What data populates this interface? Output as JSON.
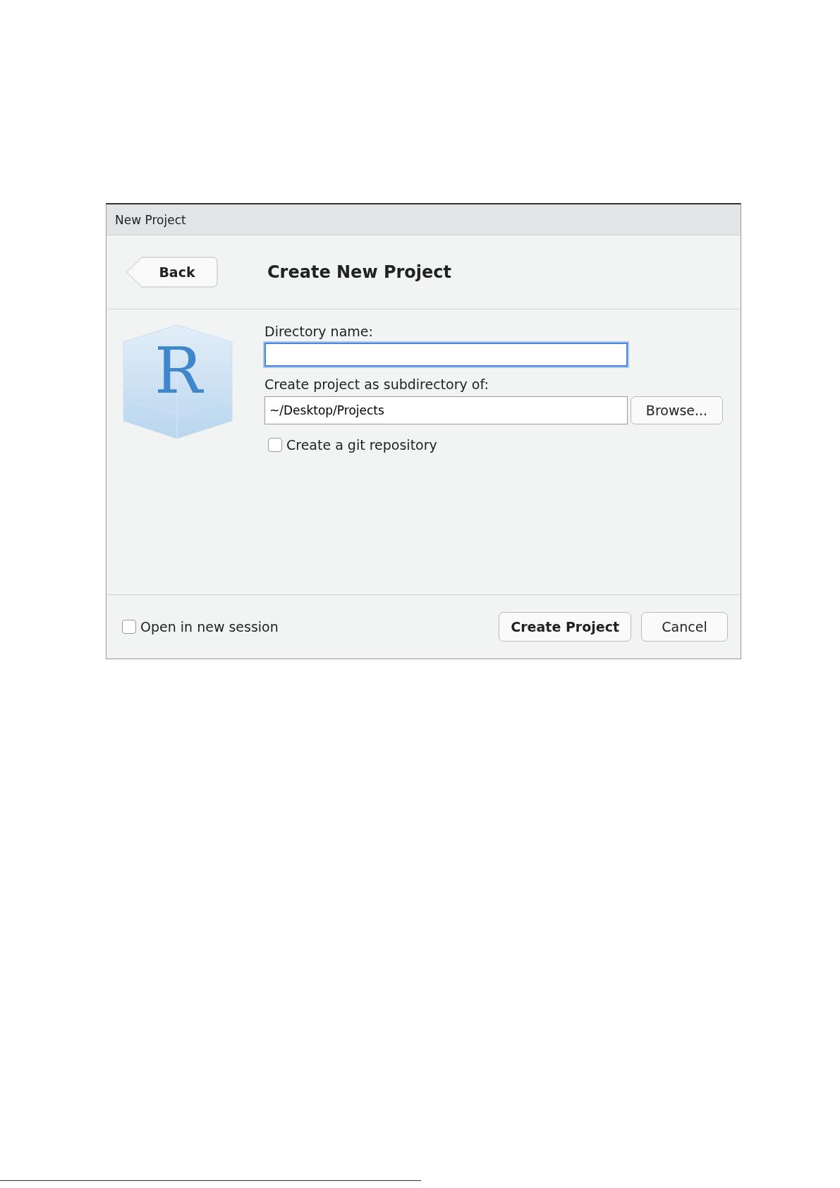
{
  "window": {
    "title": "New Project"
  },
  "header": {
    "back_button": "Back",
    "title": "Create New Project"
  },
  "logo": {
    "letter": "R"
  },
  "directory_name": {
    "label": "Directory name:",
    "focused": true
  },
  "parent_directory": {
    "label": "Create project as subdirectory of:",
    "value": "~/Desktop/Projects",
    "browse_button": "Browse..."
  },
  "git_repository": {
    "label": "Create a git repository",
    "checked": false
  },
  "footer": {
    "new_session": {
      "label": "Open in new session",
      "checked": false
    },
    "buttons": [
      {
        "label": "Create Project",
        "kind": "primary"
      },
      {
        "label": "Cancel",
        "kind": "cancel"
      }
    ]
  }
}
